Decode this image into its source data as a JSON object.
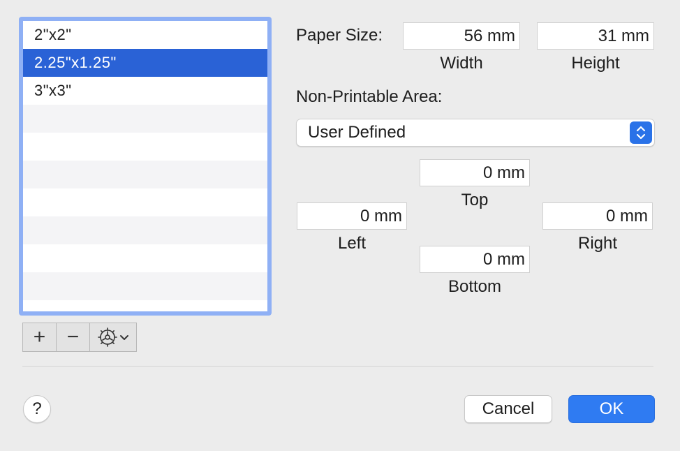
{
  "list": {
    "items": [
      {
        "label": "2\"x2\"",
        "selected": false
      },
      {
        "label": "2.25\"x1.25\"",
        "selected": true
      },
      {
        "label": "3\"x3\"",
        "selected": false
      },
      {
        "label": "",
        "selected": false
      },
      {
        "label": "",
        "selected": false
      },
      {
        "label": "",
        "selected": false
      },
      {
        "label": "",
        "selected": false
      },
      {
        "label": "",
        "selected": false
      },
      {
        "label": "",
        "selected": false
      },
      {
        "label": "",
        "selected": false
      },
      {
        "label": "",
        "selected": false
      }
    ],
    "add_symbol": "+",
    "remove_symbol": "−",
    "actions_icon": "gear-icon",
    "actions_chevron": "chevron-down-icon"
  },
  "paper_size": {
    "label": "Paper Size:",
    "width_value": "56 mm",
    "height_value": "31 mm",
    "width_label": "Width",
    "height_label": "Height"
  },
  "non_printable": {
    "label": "Non-Printable Area:",
    "popup_value": "User Defined",
    "top_value": "0 mm",
    "left_value": "0 mm",
    "right_value": "0 mm",
    "bottom_value": "0 mm",
    "top_label": "Top",
    "left_label": "Left",
    "right_label": "Right",
    "bottom_label": "Bottom"
  },
  "footer": {
    "help_label": "?",
    "cancel_label": "Cancel",
    "ok_label": "OK"
  },
  "colors": {
    "selection": "#2a62d6",
    "focus_ring": "#8fb0f5",
    "default_button": "#2f7bf2"
  }
}
